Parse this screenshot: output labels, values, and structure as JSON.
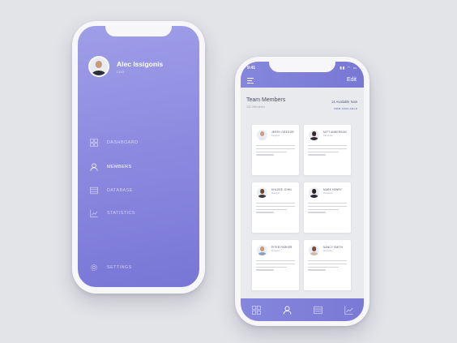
{
  "sidebar": {
    "profile": {
      "name": "Alec Issigonis",
      "role": "CEO"
    },
    "items": [
      {
        "label": "DASHBOARD",
        "icon": "dashboard-grid-icon",
        "active": false
      },
      {
        "label": "MEMBERS",
        "icon": "user-icon",
        "active": true
      },
      {
        "label": "DATABASE",
        "icon": "database-icon",
        "active": false
      },
      {
        "label": "STATISTICS",
        "icon": "chart-icon",
        "active": false
      }
    ],
    "settings_label": "SETTINGS",
    "settings_icon": "gear-icon"
  },
  "team": {
    "status_time": "9:41",
    "edit_label": "Edit",
    "title": "Team Members",
    "member_count": "132 Members",
    "available": "14 Available Now",
    "view_all": "VIEW AVAILABLE",
    "members": [
      {
        "name": "JERRY GREGOR",
        "role": "Designer"
      },
      {
        "name": "MITT ANDERSON",
        "role": "Developer"
      },
      {
        "name": "KHLOEE JOHN",
        "role": "Manager"
      },
      {
        "name": "MARK HENRY",
        "role": "Developer"
      },
      {
        "name": "PITER PARKER",
        "role": "Designer"
      },
      {
        "name": "NANCY SMITH",
        "role": "Marketing"
      }
    ]
  },
  "tabbar": {
    "tabs": [
      {
        "icon": "dashboard-grid-icon",
        "active": false
      },
      {
        "icon": "user-icon",
        "active": true
      },
      {
        "icon": "database-icon",
        "active": false
      },
      {
        "icon": "chart-icon",
        "active": false
      }
    ]
  },
  "colors": {
    "background": "#e3e4e8",
    "accent": "#8586dc",
    "accent_gradient_start": "#9f9ee8",
    "accent_gradient_end": "#7776d6",
    "text_dark": "#4c4d63"
  }
}
